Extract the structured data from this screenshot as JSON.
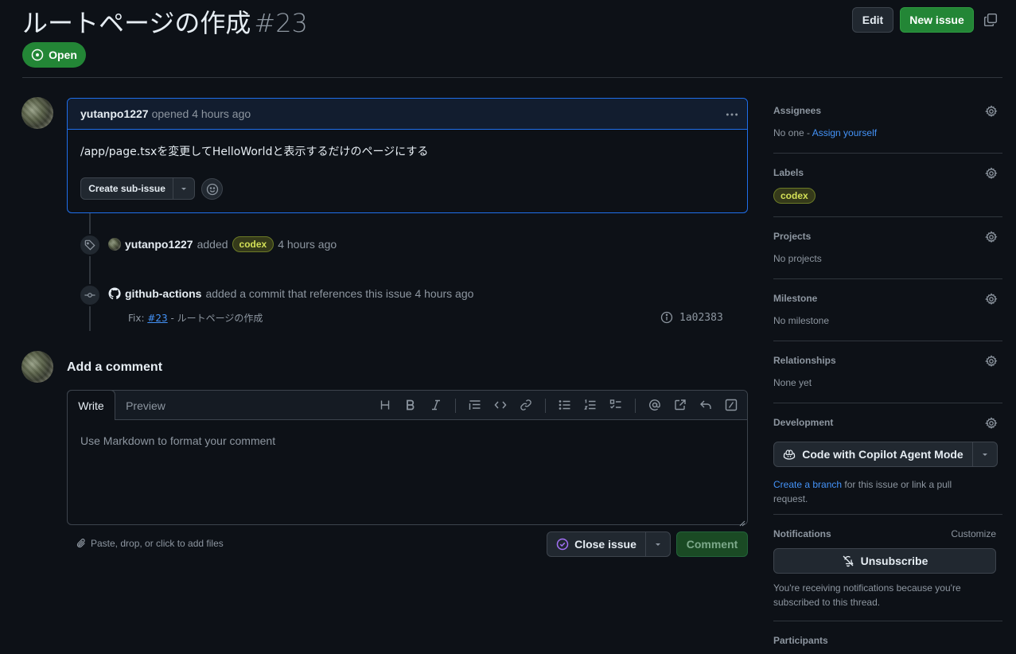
{
  "header": {
    "title": "ルートページの作成",
    "number": "#23",
    "edit_label": "Edit",
    "new_issue_label": "New issue",
    "status": "Open"
  },
  "comment": {
    "author": "yutanpo1227",
    "meta": "opened 4 hours ago",
    "body": "/app/page.tsxを変更してHelloWorldと表示するだけのページにする",
    "sub_issue_label": "Create sub-issue"
  },
  "timeline": {
    "label_event": {
      "author": "yutanpo1227",
      "action": "added",
      "label": "codex",
      "time": "4 hours ago"
    },
    "commit_event": {
      "author": "github-actions",
      "action": "added a commit that references this issue 4 hours ago",
      "message_prefix": "Fix:",
      "message_link": "#23",
      "message_suffix": "- ルートページの作成",
      "sha": "1a02383"
    }
  },
  "add_comment": {
    "title": "Add a comment",
    "tab_write": "Write",
    "tab_preview": "Preview",
    "placeholder": "Use Markdown to format your comment",
    "attach_label": "Paste, drop, or click to add files",
    "close_issue_label": "Close issue",
    "comment_label": "Comment"
  },
  "sidebar": {
    "assignees": {
      "title": "Assignees",
      "value_prefix": "No one -",
      "value_link": "Assign yourself"
    },
    "labels": {
      "title": "Labels",
      "label": "codex"
    },
    "projects": {
      "title": "Projects",
      "value": "No projects"
    },
    "milestone": {
      "title": "Milestone",
      "value": "No milestone"
    },
    "relationships": {
      "title": "Relationships",
      "value": "None yet"
    },
    "development": {
      "title": "Development",
      "copilot_label": "Code with Copilot Agent Mode",
      "link": "Create a branch",
      "text": "for this issue or link a pull request."
    },
    "notifications": {
      "title": "Notifications",
      "customize": "Customize",
      "unsubscribe": "Unsubscribe",
      "text": "You're receiving notifications because you're subscribed to this thread."
    },
    "participants": {
      "title": "Participants"
    }
  },
  "colors": {
    "background": "#0d1117",
    "accent_green": "#238636",
    "link_blue": "#4493f8",
    "label_codex": "#d4e157"
  }
}
